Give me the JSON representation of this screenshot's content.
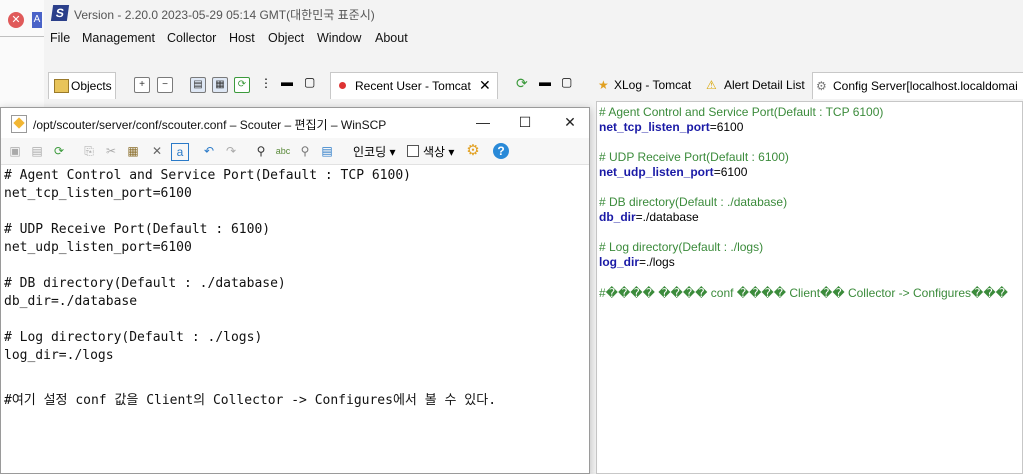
{
  "scouter": {
    "window_title": "Version - 2.20.0 2023-05-29 05:14 GMT(대한민국 표준시)",
    "menu": [
      "File",
      "Management",
      "Collector",
      "Host",
      "Object",
      "Window",
      "About"
    ],
    "left_tab": "Objects",
    "middle_tab": "Recent User - Tomcat",
    "right_tabs": [
      "XLog - Tomcat",
      "Alert Detail List",
      "Config Server[localhost.localdomai"
    ],
    "right_editor_lines": [
      {
        "type": "comment",
        "text": "# Agent Control and Service Port(Default : TCP 6100)"
      },
      {
        "type": "kv",
        "key": "net_tcp_listen_port",
        "value": "=6100"
      },
      {
        "type": "blank",
        "text": ""
      },
      {
        "type": "comment",
        "text": "# UDP Receive Port(Default : 6100)"
      },
      {
        "type": "kv",
        "key": "net_udp_listen_port",
        "value": "=6100"
      },
      {
        "type": "blank",
        "text": ""
      },
      {
        "type": "comment",
        "text": "# DB directory(Default : ./database)"
      },
      {
        "type": "kv",
        "key": "db_dir",
        "value": "=./database"
      },
      {
        "type": "blank",
        "text": ""
      },
      {
        "type": "comment",
        "text": "# Log directory(Default : ./logs)"
      },
      {
        "type": "kv",
        "key": "log_dir",
        "value": "=./logs"
      },
      {
        "type": "blank",
        "text": ""
      },
      {
        "type": "comment",
        "text": "#���� ���� conf ���� Client�� Collector -> Configures���"
      }
    ]
  },
  "winscp": {
    "title": "/opt/scouter/server/conf/scouter.conf – Scouter – 편집기 – WinSCP",
    "toolbar_encoding": "인코딩",
    "toolbar_color": "색상",
    "lines": [
      "# Agent Control and Service Port(Default : TCP 6100)",
      "net_tcp_listen_port=6100",
      "",
      "# UDP Receive Port(Default : 6100)",
      "net_udp_listen_port=6100",
      "",
      "# DB directory(Default : ./database)",
      "db_dir=./database",
      "",
      "# Log directory(Default : ./logs)",
      "log_dir=./logs",
      "",
      "#여기 설정 conf 값을 Client의 Collector -> Configures에서 볼 수 있다."
    ]
  },
  "colors": {
    "comment": "#3b8b3b",
    "key": "#1a1aa6"
  }
}
